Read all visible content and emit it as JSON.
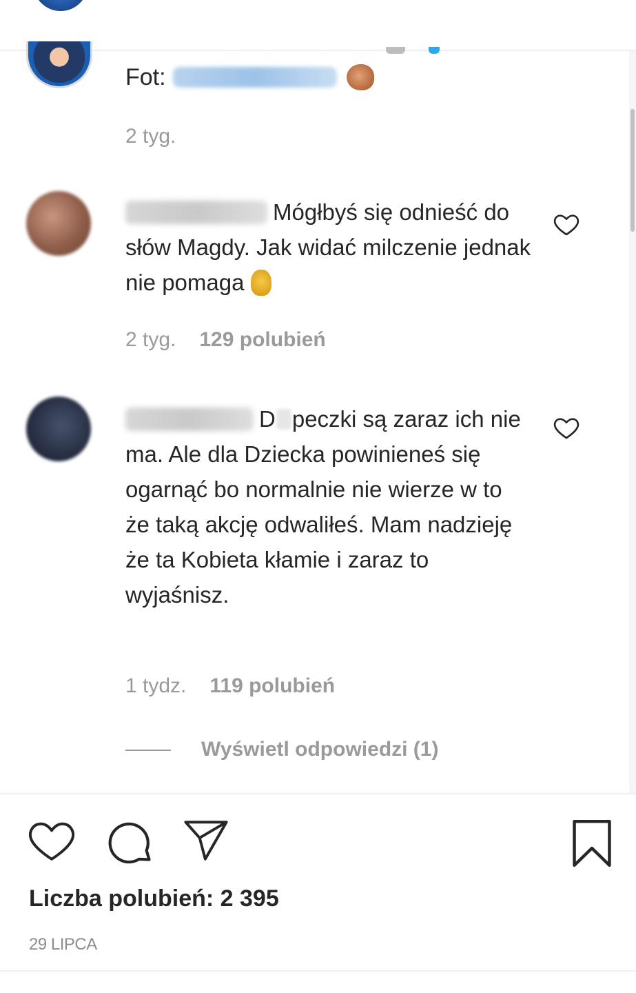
{
  "caption": {
    "prefix": "Fot:",
    "time": "2 tyg."
  },
  "comments": [
    {
      "text": "Mógłbyś się odnieść do słów Magdy. Jak widać milczenie jednak nie pomaga",
      "time": "2 tyg.",
      "likes": "129 polubień"
    },
    {
      "text_start": "D",
      "text_rest": "peczki są zaraz ich nie ma. Ale dla Dziecka powinieneś się ogarnąć bo normalnie nie wierze w to że taką akcję odwaliłeś. Mam nadzieję że ta Kobieta kłamie i zaraz to wyjaśnisz.",
      "time": "1 tydz.",
      "likes": "119 polubień",
      "replies": "Wyświetl odpowiedzi (1)"
    }
  ],
  "post": {
    "likes_total": "Liczba polubień: 2 395",
    "date": "29 LIPCA"
  },
  "icons": [
    "like-icon",
    "comment-icon",
    "share-icon",
    "save-icon"
  ],
  "colors": {
    "text": "#262626",
    "secondary": "#9a9a9a",
    "divider": "#efefef"
  }
}
